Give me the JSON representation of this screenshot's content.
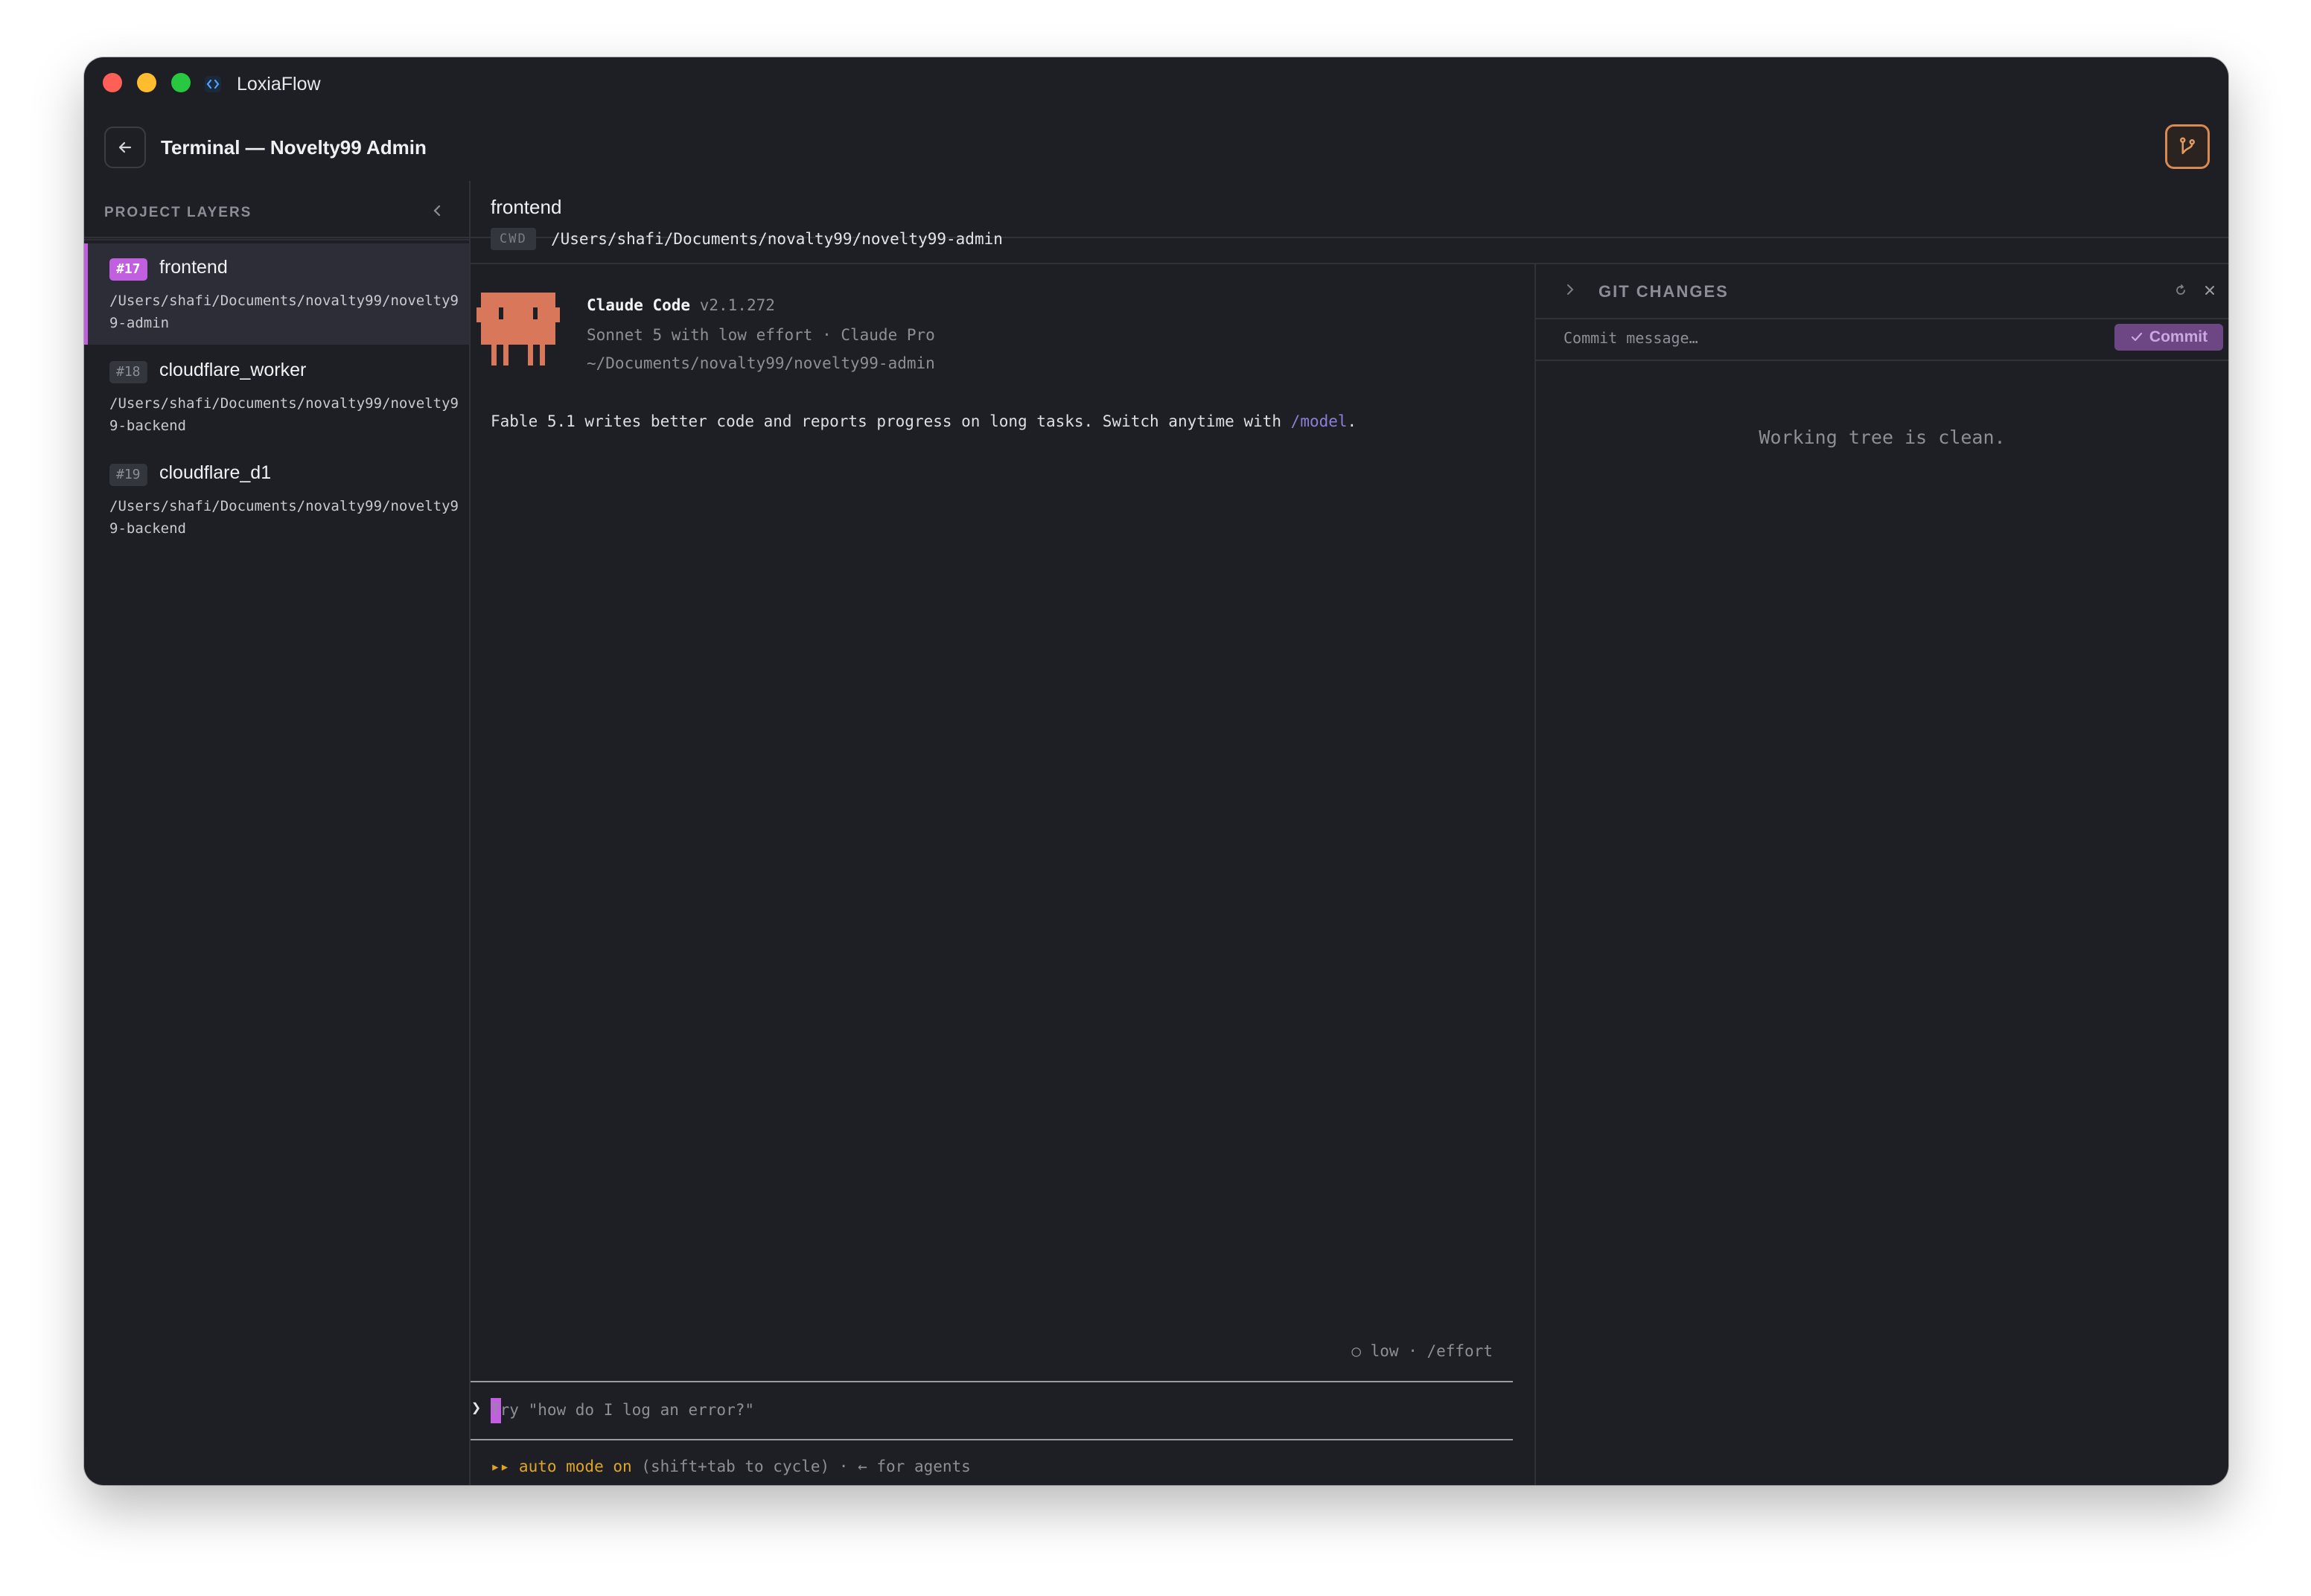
{
  "app": {
    "name": "LoxiaFlow"
  },
  "header": {
    "title": "Terminal — Novelty99 Admin"
  },
  "sidebar": {
    "heading": "PROJECT LAYERS",
    "layers": [
      {
        "badge": "#17",
        "name": "frontend",
        "path": "/Users/shafi/Documents/novalty99/novelty99-admin",
        "active": true
      },
      {
        "badge": "#18",
        "name": "cloudflare_worker",
        "path": "/Users/shafi/Documents/novalty99/novelty99-backend",
        "active": false
      },
      {
        "badge": "#19",
        "name": "cloudflare_d1",
        "path": "/Users/shafi/Documents/novalty99/novelty99-backend",
        "active": false
      }
    ]
  },
  "main": {
    "title": "frontend",
    "cwd_label": "CWD",
    "cwd_path": "/Users/shafi/Documents/novalty99/novelty99-admin"
  },
  "terminal": {
    "product": "Claude Code",
    "version": "v2.1.272",
    "model_line": "Sonnet 5 with low effort · Claude Pro",
    "dir_line": "~/Documents/novalty99/novelty99-admin",
    "notice_prefix": "Fable 5.1 writes better code and reports progress on long tasks. Switch anytime with ",
    "notice_link": "/model",
    "notice_suffix": ".",
    "effort": "○ low · /effort",
    "prompt_arrow": "❯",
    "prompt_placeholder": "Try \"how do I log an error?\"",
    "status_mode": "▸▸ auto mode on",
    "status_rest": " (shift+tab to cycle) · ← for agents"
  },
  "git": {
    "title": "GIT CHANGES",
    "commit_placeholder": "Commit message…",
    "commit_label": "Commit",
    "empty_text": "Working tree is clean."
  },
  "colors": {
    "accent": "#c15fe0",
    "mascot": "#d9775a",
    "git_toggle": "#d98a52",
    "status_mode": "#e0a526"
  }
}
